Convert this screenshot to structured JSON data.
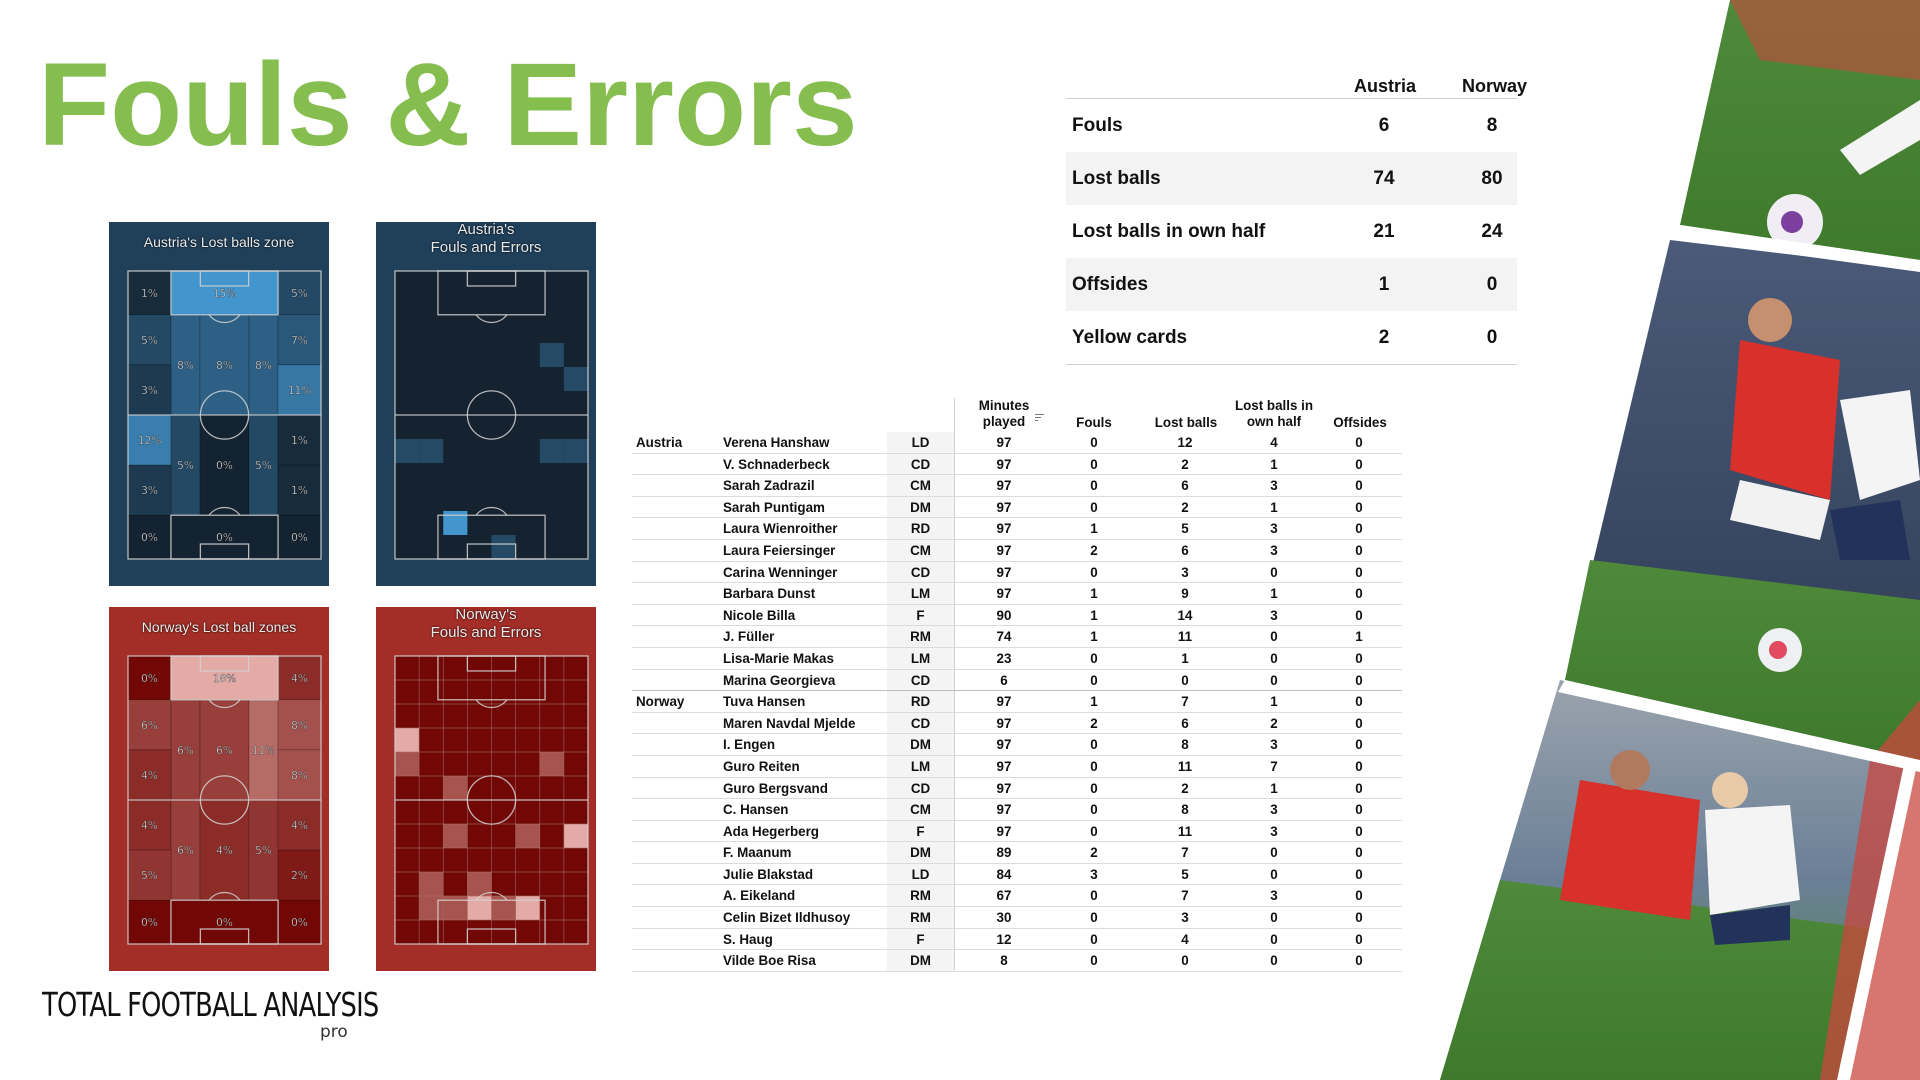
{
  "title": "Fouls & Errors",
  "summary": {
    "columns": [
      "Austria",
      "Norway"
    ],
    "rows": [
      {
        "label": "Fouls",
        "austria": "6",
        "norway": "8"
      },
      {
        "label": "Lost balls",
        "austria": "74",
        "norway": "80"
      },
      {
        "label": "Lost balls in own half",
        "austria": "21",
        "norway": "24"
      },
      {
        "label": "Offsides",
        "austria": "1",
        "norway": "0"
      },
      {
        "label": "Yellow cards",
        "austria": "2",
        "norway": "0"
      }
    ]
  },
  "pitches": {
    "austria_lost": {
      "title": "Austria's Lost balls zone",
      "zones": [
        "1%",
        "15%",
        "5%",
        "5%",
        "8%",
        "8%",
        "8%",
        "7%",
        "3%",
        "11%",
        "12%",
        "5%",
        "0%",
        "5%",
        "1%",
        "3%",
        "1%",
        "0%",
        "0%",
        "0%"
      ]
    },
    "austria_fouls": {
      "title_line1": "Austria's",
      "title_line2": "Fouls and Errors"
    },
    "norway_lost": {
      "title": "Norway's Lost ball zones",
      "zones": [
        "0%",
        "18%",
        "4%",
        "6%",
        "6%",
        "6%",
        "11%",
        "8%",
        "4%",
        "8%",
        "4%",
        "6%",
        "4%",
        "5%",
        "4%",
        "5%",
        "2%",
        "0%",
        "0%",
        "0%"
      ]
    },
    "norway_fouls": {
      "title_line1": "Norway's",
      "title_line2": "Fouls and Errors"
    }
  },
  "colors": {
    "title_green": "#86bd4f",
    "austria_panel": "#20405a",
    "norway_panel": "#a32e27"
  },
  "players_table": {
    "headers": {
      "minutes_line1": "Minutes",
      "minutes_line2": "played",
      "fouls": "Fouls",
      "lost": "Lost balls",
      "own_line1": "Lost balls in",
      "own_line2": "own half",
      "offsides": "Offsides"
    },
    "sort_icon": "sort-descending-icon",
    "rows": [
      {
        "team": "Austria",
        "name": "Verena Hanshaw",
        "pos": "LD",
        "min": "97",
        "fouls": "0",
        "lost": "12",
        "own": "4",
        "off": "0"
      },
      {
        "team": "",
        "name": "V. Schnaderbeck",
        "pos": "CD",
        "min": "97",
        "fouls": "0",
        "lost": "2",
        "own": "1",
        "off": "0"
      },
      {
        "team": "",
        "name": "Sarah Zadrazil",
        "pos": "CM",
        "min": "97",
        "fouls": "0",
        "lost": "6",
        "own": "3",
        "off": "0"
      },
      {
        "team": "",
        "name": "Sarah Puntigam",
        "pos": "DM",
        "min": "97",
        "fouls": "0",
        "lost": "2",
        "own": "1",
        "off": "0"
      },
      {
        "team": "",
        "name": "Laura Wienroither",
        "pos": "RD",
        "min": "97",
        "fouls": "1",
        "lost": "5",
        "own": "3",
        "off": "0"
      },
      {
        "team": "",
        "name": "Laura Feiersinger",
        "pos": "CM",
        "min": "97",
        "fouls": "2",
        "lost": "6",
        "own": "3",
        "off": "0"
      },
      {
        "team": "",
        "name": "Carina Wenninger",
        "pos": "CD",
        "min": "97",
        "fouls": "0",
        "lost": "3",
        "own": "0",
        "off": "0"
      },
      {
        "team": "",
        "name": "Barbara Dunst",
        "pos": "LM",
        "min": "97",
        "fouls": "1",
        "lost": "9",
        "own": "1",
        "off": "0"
      },
      {
        "team": "",
        "name": "Nicole Billa",
        "pos": "F",
        "min": "90",
        "fouls": "1",
        "lost": "14",
        "own": "3",
        "off": "0"
      },
      {
        "team": "",
        "name": "J. Füller",
        "pos": "RM",
        "min": "74",
        "fouls": "1",
        "lost": "11",
        "own": "0",
        "off": "1"
      },
      {
        "team": "",
        "name": "Lisa-Marie Makas",
        "pos": "LM",
        "min": "23",
        "fouls": "0",
        "lost": "1",
        "own": "0",
        "off": "0"
      },
      {
        "team": "",
        "name": "Marina Georgieva",
        "pos": "CD",
        "min": "6",
        "fouls": "0",
        "lost": "0",
        "own": "0",
        "off": "0"
      },
      {
        "team": "Norway",
        "name": "Tuva Hansen",
        "pos": "RD",
        "min": "97",
        "fouls": "1",
        "lost": "7",
        "own": "1",
        "off": "0"
      },
      {
        "team": "",
        "name": "Maren Navdal Mjelde",
        "pos": "CD",
        "min": "97",
        "fouls": "2",
        "lost": "6",
        "own": "2",
        "off": "0"
      },
      {
        "team": "",
        "name": "I. Engen",
        "pos": "DM",
        "min": "97",
        "fouls": "0",
        "lost": "8",
        "own": "3",
        "off": "0"
      },
      {
        "team": "",
        "name": "Guro Reiten",
        "pos": "LM",
        "min": "97",
        "fouls": "0",
        "lost": "11",
        "own": "7",
        "off": "0"
      },
      {
        "team": "",
        "name": "Guro Bergsvand",
        "pos": "CD",
        "min": "97",
        "fouls": "0",
        "lost": "2",
        "own": "1",
        "off": "0"
      },
      {
        "team": "",
        "name": "C. Hansen",
        "pos": "CM",
        "min": "97",
        "fouls": "0",
        "lost": "8",
        "own": "3",
        "off": "0"
      },
      {
        "team": "",
        "name": "Ada Hegerberg",
        "pos": "F",
        "min": "97",
        "fouls": "0",
        "lost": "11",
        "own": "3",
        "off": "0"
      },
      {
        "team": "",
        "name": "F. Maanum",
        "pos": "DM",
        "min": "89",
        "fouls": "2",
        "lost": "7",
        "own": "0",
        "off": "0"
      },
      {
        "team": "",
        "name": "Julie Blakstad",
        "pos": "LD",
        "min": "84",
        "fouls": "3",
        "lost": "5",
        "own": "0",
        "off": "0"
      },
      {
        "team": "",
        "name": "A. Eikeland",
        "pos": "RM",
        "min": "67",
        "fouls": "0",
        "lost": "7",
        "own": "3",
        "off": "0"
      },
      {
        "team": "",
        "name": "Celin Bizet Ildhusoy",
        "pos": "RM",
        "min": "30",
        "fouls": "0",
        "lost": "3",
        "own": "0",
        "off": "0"
      },
      {
        "team": "",
        "name": "S. Haug",
        "pos": "F",
        "min": "12",
        "fouls": "0",
        "lost": "4",
        "own": "0",
        "off": "0"
      },
      {
        "team": "",
        "name": "Vilde Boe Risa",
        "pos": "DM",
        "min": "8",
        "fouls": "0",
        "lost": "0",
        "own": "0",
        "off": "0"
      }
    ]
  },
  "logo": {
    "text": "TOTAL FOOTBALL ANALYSIS",
    "sub": "pro"
  }
}
